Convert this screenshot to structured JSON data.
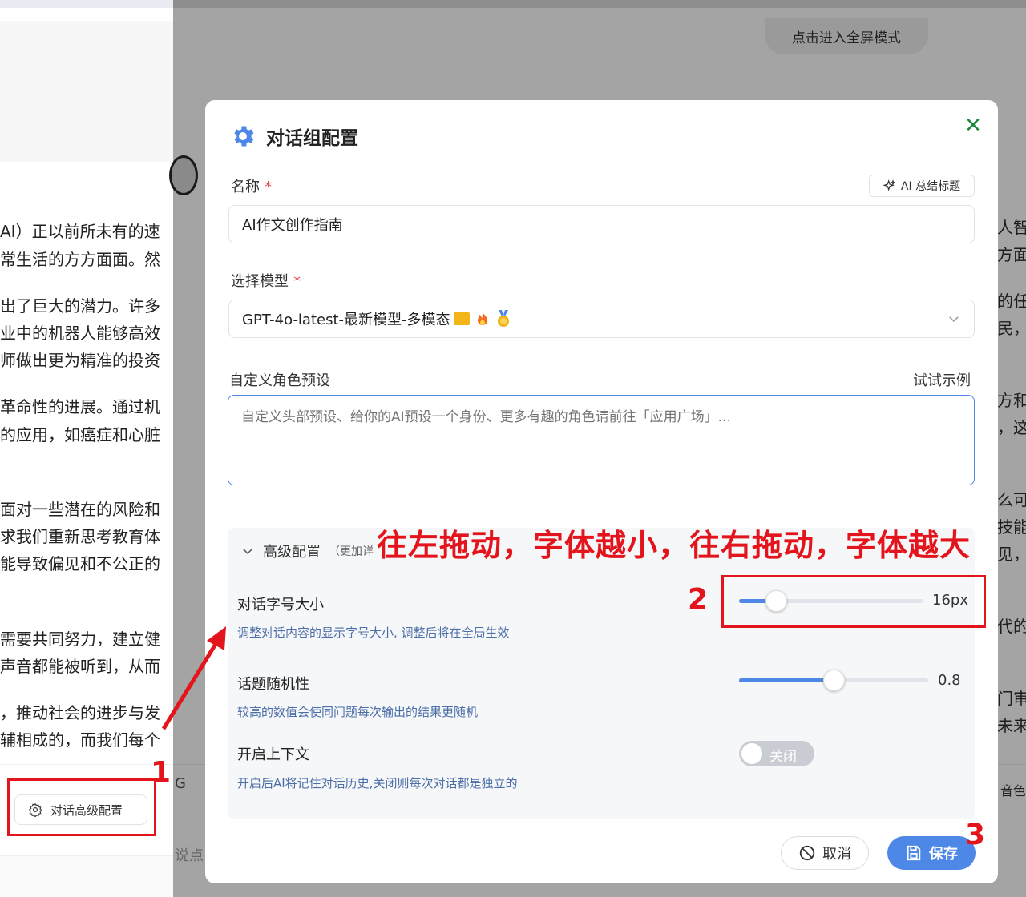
{
  "left_pane": {
    "lines": [
      "AI）正以前所未有的速",
      "常生活的方方面面。然",
      "出了巨大的潜力。许多",
      "业中的机器人能够高效",
      "师做出更为精准的投资",
      "革命性的进展。通过机",
      "的应用，如癌症和心脏",
      "面对一些潜在的风险和",
      "求我们重新思考教育体",
      "能导致偏见和不公正的",
      "需要共同努力，建立健",
      "声音都能被听到，从而",
      "，推动社会的进步与发",
      "辅相成的，而我们每个"
    ],
    "advanced_btn_label": "对话高级配置"
  },
  "background": {
    "fullscreen_label": "点击进入全屏模式",
    "right_fragments": [
      "人智",
      "方面",
      "的任",
      "民，",
      "方和",
      "，这",
      "么可",
      "技能",
      "见，",
      "代的",
      "门审",
      "未来"
    ],
    "chip_g": "G",
    "chip_right": "音色",
    "say_placeholder": "说点"
  },
  "modal": {
    "title": "对话组配置",
    "name_label": "名称",
    "required_mark": "*",
    "ai_title_button": "AI 总结标题",
    "name_value": "AI作文创作指南",
    "model_label": "选择模型",
    "model_value": "GPT-4o-latest-最新模型-多模态",
    "role_label": "自定义角色预设",
    "try_example": "试试示例",
    "role_placeholder": "自定义头部预设、给你的AI预设一个身份、更多有趣的角色请前往「应用广场」...",
    "advanced": {
      "title": "高级配置",
      "subtitle": "（更加详",
      "font_size": {
        "label": "对话字号大小",
        "description": "调整对话内容的显示字号大小, 调整后将在全局生效",
        "value_text": "16px",
        "fraction": 0.2
      },
      "randomness": {
        "label": "话题随机性",
        "description": "较高的数值会使同问题每次输出的结果更随机",
        "value_text": "0.8",
        "fraction": 0.5
      },
      "context": {
        "label": "开启上下文",
        "description": "开启后AI将记住对话历史,关闭则每次对话都是独立的",
        "toggle_text": "关闭"
      }
    },
    "cancel_label": "取消",
    "save_label": "保存"
  },
  "annotations": {
    "banner": "往左拖动，字体越小，往右拖动，字体越大",
    "num1": "1",
    "num2": "2",
    "num3": "3"
  },
  "colors": {
    "accent": "#4e88e6",
    "annotation_red": "#e3141b",
    "close_green": "#1a8a3a"
  }
}
